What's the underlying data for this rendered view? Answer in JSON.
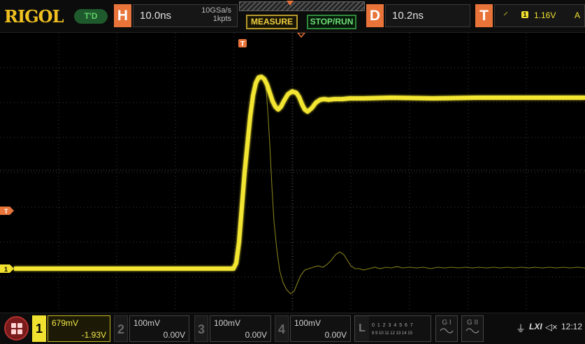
{
  "brand": {
    "logo": "RIGOL",
    "trigger_status": "T'D"
  },
  "horizontal": {
    "label": "H",
    "timebase": "10.0ns",
    "sample_rate": "10GSa/s",
    "memory_depth": "1kpts"
  },
  "buttons": {
    "measure": "MEASURE",
    "stop_run": "STOP/RUN"
  },
  "delay": {
    "label": "D",
    "value": "10.2ns"
  },
  "trigger": {
    "label": "T",
    "edge_icon": "rising-edge-icon",
    "source": "1",
    "level": "1.16V",
    "mode": "A"
  },
  "waveform_markers": {
    "trigger_marker": "T",
    "ch1_trigger_level": "T",
    "ch1_ground": "1"
  },
  "channels": [
    {
      "id": "1",
      "scale": "679mV",
      "offset": "-1.93V",
      "active": true,
      "color": "#f0e030"
    },
    {
      "id": "2",
      "scale": "100mV",
      "offset": "0.00V",
      "active": false
    },
    {
      "id": "3",
      "scale": "100mV",
      "offset": "0.00V",
      "active": false
    },
    {
      "id": "4",
      "scale": "100mV",
      "offset": "0.00V",
      "active": false
    }
  ],
  "logic": {
    "label": "L",
    "bits_row1": "0 1 2 3 4 5 6 7",
    "bits_row2": "8 9 10 11 12 13 14 15"
  },
  "generators": [
    {
      "label": "G I"
    },
    {
      "label": "G II"
    }
  ],
  "status_bar": {
    "clock": "12:12",
    "usb_icon": "usb-icon",
    "lan_icon": "lan-icon",
    "sound_icon": "speaker-icon"
  },
  "colors": {
    "trace": "#f0e030",
    "accent": "#e8743a",
    "grid": "#3a3a3a"
  }
}
